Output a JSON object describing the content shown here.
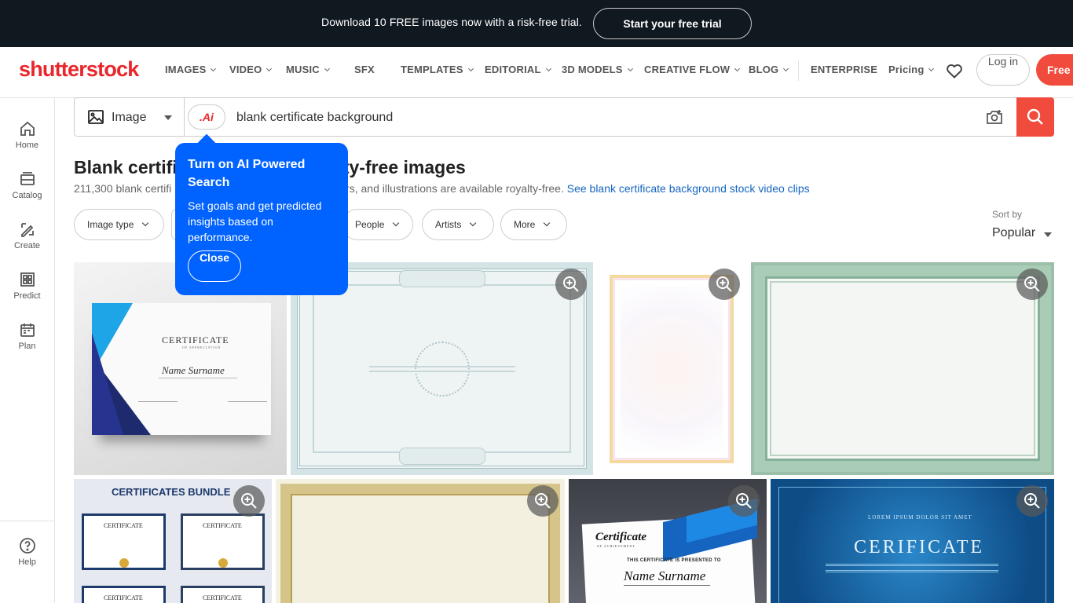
{
  "promo": {
    "text": "Download 10 FREE images now with a risk-free trial.",
    "button": "Start your free trial"
  },
  "header": {
    "logo": "shutterstock",
    "nav": [
      "IMAGES",
      "VIDEO",
      "MUSIC",
      "SFX",
      "TEMPLATES",
      "EDITORIAL",
      "3D MODELS",
      "CREATIVE FLOW",
      "BLOG",
      "ENTERPRISE",
      "Pricing"
    ],
    "login": "Log in",
    "free": "Free t"
  },
  "sidebar": {
    "items": [
      "Home",
      "Catalog",
      "Create",
      "Predict",
      "Plan"
    ],
    "help": "Help"
  },
  "search": {
    "type": "Image",
    "ai": ".Ai",
    "query": "blank certificate background"
  },
  "results": {
    "title_start": "Blank certifi",
    "title_end": "alty-free images",
    "sub_start": "211,300 blank certifi",
    "sub_end": "ors, and illustrations are available royalty-free.",
    "video_link": "See blank certificate background stock video clips"
  },
  "filters": [
    "Image type",
    "People",
    "Artists",
    "More"
  ],
  "sort": {
    "label": "Sort by",
    "value": "Popular"
  },
  "popover": {
    "title": "Turn on AI Powered Search",
    "body": "Set goals and get predicted insights based on performance.",
    "close": "Close"
  },
  "thumbs": {
    "t1_title": "CERTIFICATE",
    "t1_sub": "OF APPRECIATION",
    "t1_name": "Name Surname",
    "t5_title": "CERTIFICATES BUNDLE",
    "t5_card": "CERTIFICATE",
    "t7_title": "Certificate",
    "t7_sub": "OF ACHIEVEMENT",
    "t7_line": "THIS CERTIFICATE IS PRESENTED TO",
    "t7_name": "Name Surname",
    "t8_top": "LOREM IPSUM DOLOR SIT AMET",
    "t8_title": "CERIFICATE"
  }
}
